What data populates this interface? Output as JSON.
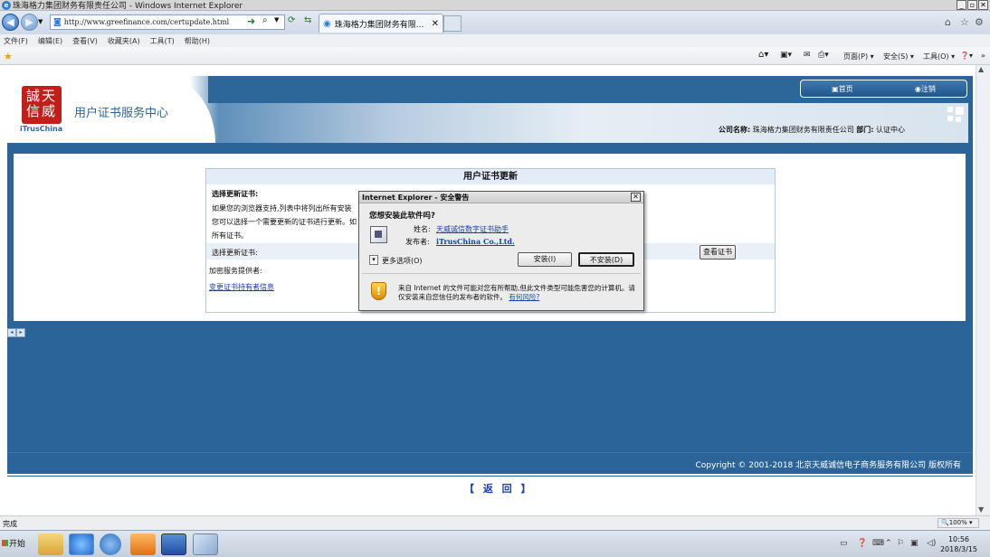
{
  "window": {
    "title": "珠海格力集团财务有限责任公司 - Windows Internet Explorer",
    "url": "http://www.greefinance.com/certupdate.html",
    "tab_label": "珠海格力集团财务有限...",
    "menu": [
      "文件(F)",
      "编辑(E)",
      "查看(V)",
      "收藏夹(A)",
      "工具(T)",
      "帮助(H)"
    ],
    "commands": {
      "page": "页面(P) ▾",
      "safety": "安全(S) ▾",
      "tools": "工具(O) ▾",
      "help": "❓▾"
    }
  },
  "site": {
    "logo_cn": "誠天\n信威",
    "logo_en": "iTrusChina",
    "title": "用户证书服务中心",
    "nav": {
      "home": "首页",
      "logout": "注销"
    },
    "org_label": "公司名称:",
    "org_name": "珠海格力集团财务有限责任公司",
    "dept_label": "部门:",
    "dept_name": "认证中心"
  },
  "panel": {
    "title": "用户证书更新",
    "section_heading": "选择更新证书:",
    "desc_line1": "如果您的浏览器支持,列表中将列出所有安装",
    "desc_line2": "您可以选择一个需要更新的证书进行更新。如",
    "desc_line3": "所有证书。",
    "select_label": "选择更新证书:",
    "view_cert_button": "查看证书",
    "csp_label": "加密服务提供者:",
    "change_holder_link": "变更证书持有者信息"
  },
  "dialog": {
    "title": "Internet Explorer - 安全警告",
    "question": "您想安装此软件吗?",
    "name_label": "姓名:",
    "name_value": "天威诚信数字证书助手",
    "publisher_label": "发布者:",
    "publisher_value": "iTrusChina Co.,Ltd.",
    "more_options": "更多选项(O)",
    "install_button": "安装(I)",
    "dont_install_button": "不安装(D)",
    "warning_text": "来自 Internet 的文件可能对您有所帮助,但此文件类型可能危害您的计算机。请仅安装来自您信任的发布者的软件。",
    "risk_link": "有何风险?"
  },
  "footer": {
    "copyright": "Copyright © 2001-2018 北京天威诚信电子商务服务有限公司 版权所有",
    "back_link": "【 返 回 】"
  },
  "status": {
    "text": "完成",
    "zoom": "🔍100% ▾"
  },
  "taskbar": {
    "start_label": "开始",
    "time": "10:56",
    "date": "2018/3/15"
  }
}
